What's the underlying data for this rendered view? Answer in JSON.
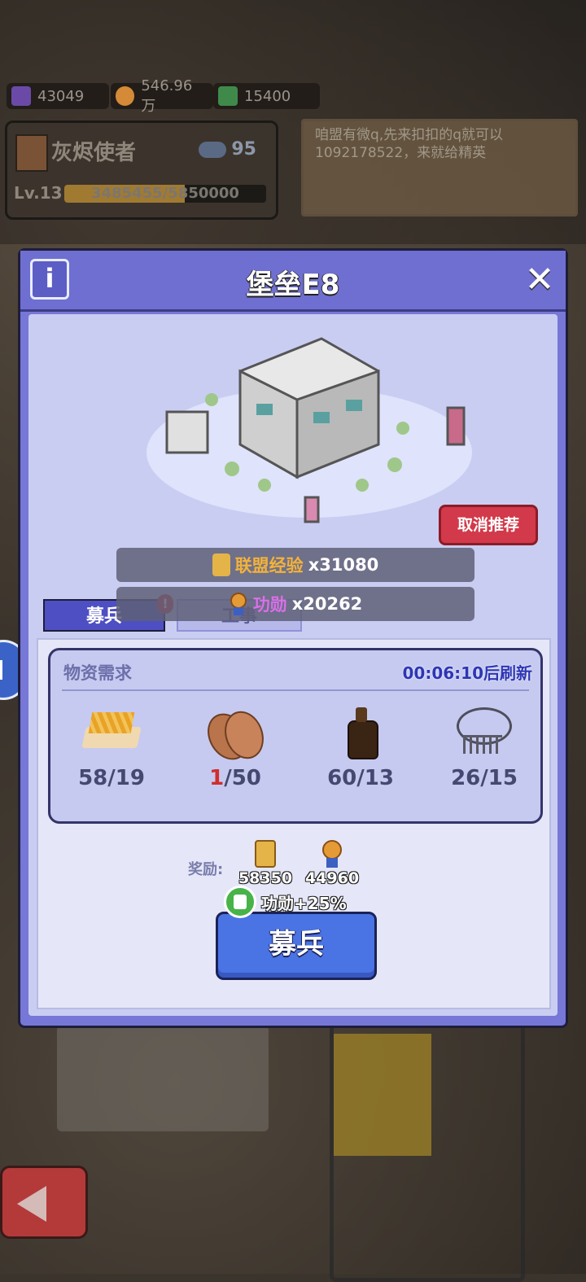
{
  "top": {
    "resources": [
      {
        "icon": "blueprint-icon",
        "value": "43049"
      },
      {
        "icon": "medal-icon",
        "value": "546.96万"
      },
      {
        "icon": "book-icon",
        "value": "15400"
      }
    ],
    "player": {
      "name": "灰烬使者",
      "members": "95",
      "level": "Lv.13",
      "xp_text": "3485455/5850000",
      "xp_fraction": 0.596
    },
    "notice": "咱盟有微q,先来扣扣的q就可以1092178522，来就给精英"
  },
  "modal": {
    "title": "堡垒E8",
    "info_label": "i",
    "close_label": "✕",
    "cancel_recommend": "取消推荐",
    "rewards_preview": [
      {
        "label": "联盟经验",
        "amount": "x31080"
      },
      {
        "label": "功勋",
        "amount": "x20262"
      }
    ],
    "tabs": [
      {
        "label": "募兵",
        "badge": "!"
      },
      {
        "label": "工事"
      }
    ],
    "supply": {
      "title": "物资需求",
      "timer": "00:06:10后刷新",
      "items": [
        {
          "icon": "fries-icon",
          "have": "58",
          "need": "/19",
          "short": false
        },
        {
          "icon": "cocoa-beans-icon",
          "have": "1",
          "need": "/50",
          "short": true
        },
        {
          "icon": "sauce-bottle-icon",
          "have": "60",
          "need": "/13",
          "short": false
        },
        {
          "icon": "fishbone-necklace-icon",
          "have": "26",
          "need": "/15",
          "short": false
        }
      ]
    },
    "reward": {
      "label": "奖励:",
      "items": [
        {
          "icon": "alliance-exp-icon",
          "value": "58350"
        },
        {
          "icon": "merit-medal-icon",
          "value": "44960"
        }
      ],
      "bonus": "功勋+25%"
    },
    "recruit_button": "募兵"
  }
}
